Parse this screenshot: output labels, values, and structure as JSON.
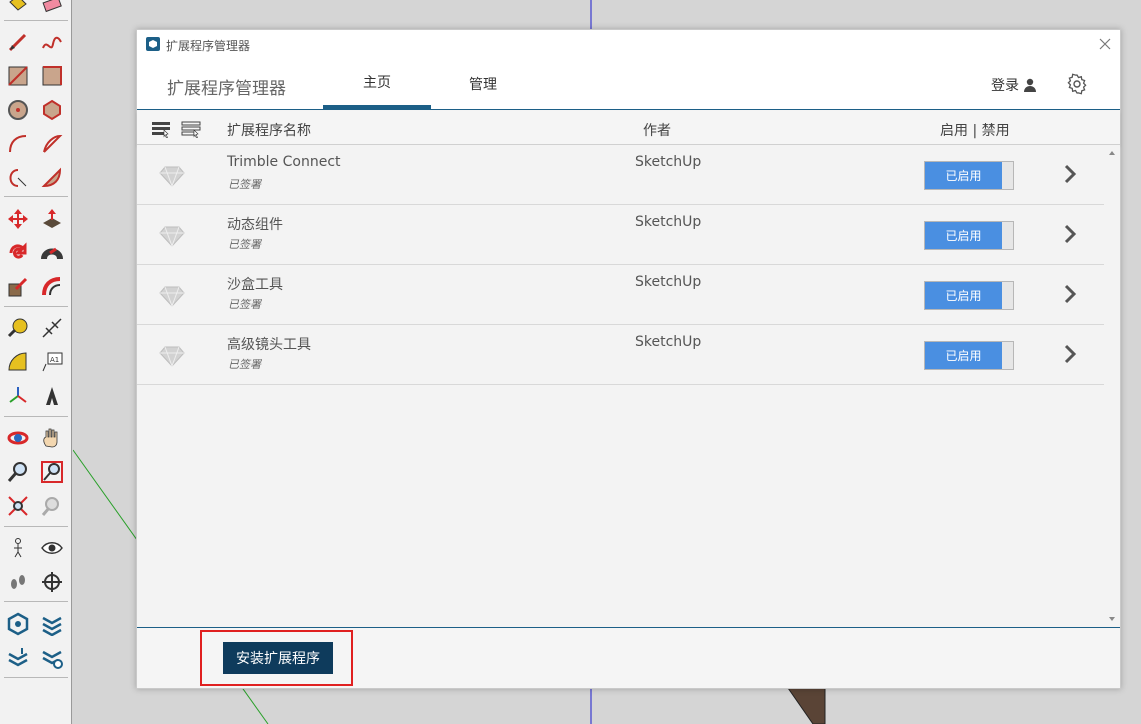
{
  "dialog": {
    "title": "扩展程序管理器",
    "brand": "扩展程序管理器",
    "tabs": [
      {
        "label": "主页",
        "active": true
      },
      {
        "label": "管理",
        "active": false
      }
    ],
    "login_label": "登录",
    "icons": {
      "app": "sketchup-icon",
      "close": "close-icon",
      "user": "user-icon",
      "settings": "gear-icon"
    }
  },
  "table": {
    "columns": {
      "name": "扩展程序名称",
      "author": "作者",
      "status": "启用 | 禁用"
    },
    "rows": [
      {
        "name": "Trimble Connect",
        "signed": "已签署",
        "author": "SketchUp",
        "status": "已启用"
      },
      {
        "name": "动态组件",
        "signed": "已签署",
        "author": "SketchUp",
        "status": "已启用"
      },
      {
        "name": "沙盒工具",
        "signed": "已签署",
        "author": "SketchUp",
        "status": "已启用"
      },
      {
        "name": "高级镜头工具",
        "signed": "已签署",
        "author": "SketchUp",
        "status": "已启用"
      }
    ]
  },
  "footer": {
    "install_label": "安装扩展程序"
  },
  "colors": {
    "accent": "#1c5f87",
    "toggle_on": "#4a8fe1",
    "install_button": "#0e3b5c",
    "highlight": "#e02020"
  }
}
